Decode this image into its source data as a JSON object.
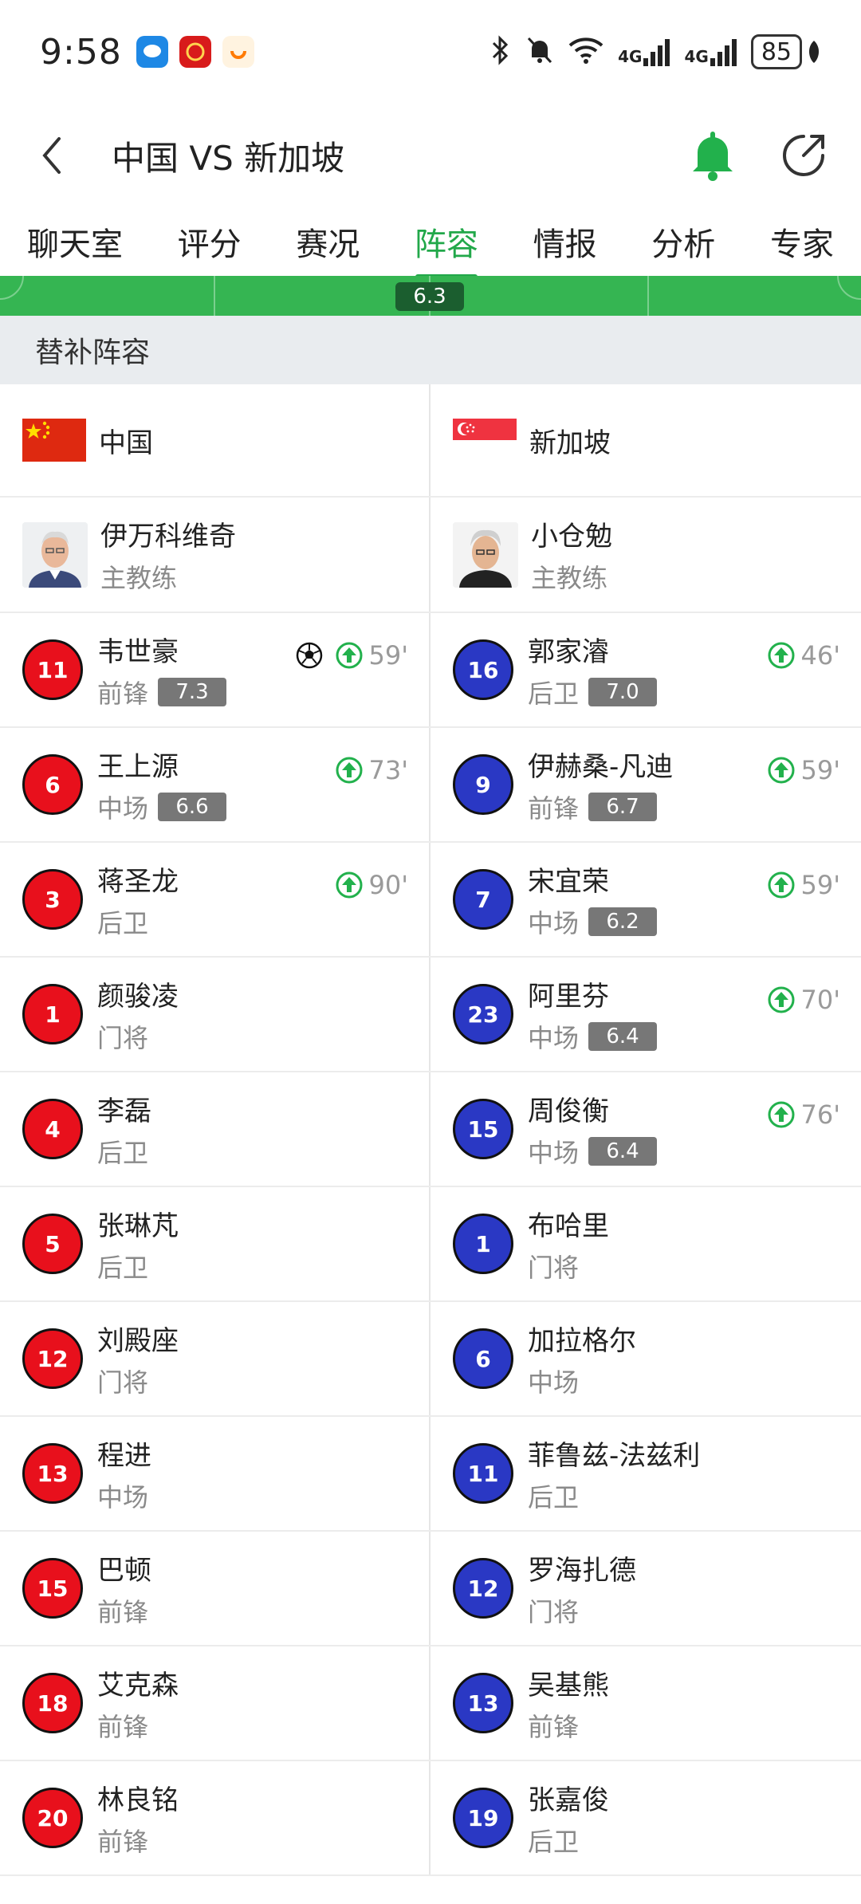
{
  "status_bar": {
    "time": "9:58",
    "battery": "85",
    "network_1": "4G",
    "network_2": "4G"
  },
  "header": {
    "title": "中国 VS 新加坡"
  },
  "tabs": [
    {
      "label": "聊天室",
      "active": false
    },
    {
      "label": "评分",
      "active": false
    },
    {
      "label": "赛况",
      "active": false
    },
    {
      "label": "阵容",
      "active": true
    },
    {
      "label": "情报",
      "active": false
    },
    {
      "label": "分析",
      "active": false
    },
    {
      "label": "专家",
      "active": false
    }
  ],
  "field": {
    "team_rating": "6.3"
  },
  "section": {
    "title": "替补阵容"
  },
  "home": {
    "name": "中国",
    "coach": {
      "name": "伊万科维奇",
      "role": "主教练"
    }
  },
  "away": {
    "name": "新加坡",
    "coach": {
      "name": "小仓勉",
      "role": "主教练"
    }
  },
  "rows": [
    {
      "l": {
        "num": "11",
        "name": "韦世豪",
        "pos": "前锋",
        "rating": "7.3",
        "goal": true,
        "sub": "59'"
      },
      "r": {
        "num": "16",
        "name": "郭家濬",
        "pos": "后卫",
        "rating": "7.0",
        "goal": false,
        "sub": "46'"
      }
    },
    {
      "l": {
        "num": "6",
        "name": "王上源",
        "pos": "中场",
        "rating": "6.6",
        "goal": false,
        "sub": "73'"
      },
      "r": {
        "num": "9",
        "name": "伊赫桑-凡迪",
        "pos": "前锋",
        "rating": "6.7",
        "goal": false,
        "sub": "59'"
      }
    },
    {
      "l": {
        "num": "3",
        "name": "蒋圣龙",
        "pos": "后卫",
        "rating": "",
        "goal": false,
        "sub": "90'"
      },
      "r": {
        "num": "7",
        "name": "宋宜荣",
        "pos": "中场",
        "rating": "6.2",
        "goal": false,
        "sub": "59'"
      }
    },
    {
      "l": {
        "num": "1",
        "name": "颜骏凌",
        "pos": "门将",
        "rating": "",
        "goal": false,
        "sub": ""
      },
      "r": {
        "num": "23",
        "name": "阿里芬",
        "pos": "中场",
        "rating": "6.4",
        "goal": false,
        "sub": "70'"
      }
    },
    {
      "l": {
        "num": "4",
        "name": "李磊",
        "pos": "后卫",
        "rating": "",
        "goal": false,
        "sub": ""
      },
      "r": {
        "num": "15",
        "name": "周俊衡",
        "pos": "中场",
        "rating": "6.4",
        "goal": false,
        "sub": "76'"
      }
    },
    {
      "l": {
        "num": "5",
        "name": "张琳芃",
        "pos": "后卫",
        "rating": "",
        "goal": false,
        "sub": ""
      },
      "r": {
        "num": "1",
        "name": "布哈里",
        "pos": "门将",
        "rating": "",
        "goal": false,
        "sub": ""
      }
    },
    {
      "l": {
        "num": "12",
        "name": "刘殿座",
        "pos": "门将",
        "rating": "",
        "goal": false,
        "sub": ""
      },
      "r": {
        "num": "6",
        "name": "加拉格尔",
        "pos": "中场",
        "rating": "",
        "goal": false,
        "sub": ""
      }
    },
    {
      "l": {
        "num": "13",
        "name": "程进",
        "pos": "中场",
        "rating": "",
        "goal": false,
        "sub": ""
      },
      "r": {
        "num": "11",
        "name": "菲鲁兹-法兹利",
        "pos": "后卫",
        "rating": "",
        "goal": false,
        "sub": ""
      }
    },
    {
      "l": {
        "num": "15",
        "name": "巴顿",
        "pos": "前锋",
        "rating": "",
        "goal": false,
        "sub": ""
      },
      "r": {
        "num": "12",
        "name": "罗海扎德",
        "pos": "门将",
        "rating": "",
        "goal": false,
        "sub": ""
      }
    },
    {
      "l": {
        "num": "18",
        "name": "艾克森",
        "pos": "前锋",
        "rating": "",
        "goal": false,
        "sub": ""
      },
      "r": {
        "num": "13",
        "name": "吴基熊",
        "pos": "前锋",
        "rating": "",
        "goal": false,
        "sub": ""
      }
    },
    {
      "l": {
        "num": "20",
        "name": "林良铭",
        "pos": "前锋",
        "rating": "",
        "goal": false,
        "sub": ""
      },
      "r": {
        "num": "19",
        "name": "张嘉俊",
        "pos": "后卫",
        "rating": "",
        "goal": false,
        "sub": ""
      }
    }
  ],
  "colors": {
    "accent": "#22a84a",
    "home": "#e8101c",
    "away": "#2a38c4"
  }
}
